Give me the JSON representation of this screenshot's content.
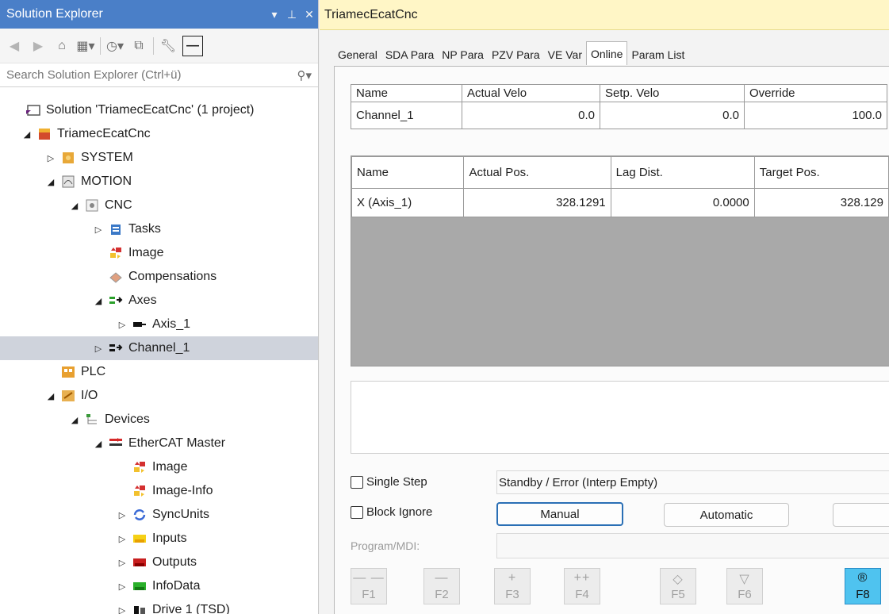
{
  "solution_explorer": {
    "title": "Solution Explorer",
    "title_controls": [
      "▾",
      "ᵖ",
      "✕"
    ],
    "search_placeholder": "Search Solution Explorer (Ctrl+ü)",
    "tree": [
      {
        "label": "Solution 'TriamecEcatCnc' (1 project)",
        "depth": 0,
        "expander": "",
        "icon": "solution-icon"
      },
      {
        "label": "TriamecEcatCnc",
        "depth": 1,
        "expander": "◢",
        "icon": "project-icon"
      },
      {
        "label": "SYSTEM",
        "depth": 2,
        "expander": "▷",
        "icon": "system-icon"
      },
      {
        "label": "MOTION",
        "depth": 2,
        "expander": "◢",
        "icon": "motion-icon"
      },
      {
        "label": "CNC",
        "depth": 3,
        "expander": "◢",
        "icon": "cnc-icon"
      },
      {
        "label": "Tasks",
        "depth": 4,
        "expander": "▷",
        "icon": "tasks-icon"
      },
      {
        "label": "Image",
        "depth": 4,
        "expander": "",
        "icon": "image-icon"
      },
      {
        "label": "Compensations",
        "depth": 4,
        "expander": "",
        "icon": "compensations-icon"
      },
      {
        "label": "Axes",
        "depth": 4,
        "expander": "◢",
        "icon": "axes-icon"
      },
      {
        "label": "Axis_1",
        "depth": 5,
        "expander": "▷",
        "icon": "axis-icon"
      },
      {
        "label": "Channel_1",
        "depth": 4,
        "expander": "▷",
        "icon": "channel-icon",
        "selected": true
      },
      {
        "label": "PLC",
        "depth": 2,
        "expander": "",
        "icon": "plc-icon"
      },
      {
        "label": "I/O",
        "depth": 2,
        "expander": "◢",
        "icon": "io-icon"
      },
      {
        "label": "Devices",
        "depth": 3,
        "expander": "◢",
        "icon": "devices-icon"
      },
      {
        "label": "EtherCAT Master",
        "depth": 4,
        "expander": "◢",
        "icon": "ethercat-icon"
      },
      {
        "label": "Image",
        "depth": 5,
        "expander": "",
        "icon": "image-icon"
      },
      {
        "label": "Image-Info",
        "depth": 5,
        "expander": "",
        "icon": "image-icon"
      },
      {
        "label": "SyncUnits",
        "depth": 5,
        "expander": "▷",
        "icon": "syncunits-icon"
      },
      {
        "label": "Inputs",
        "depth": 5,
        "expander": "▷",
        "icon": "inputs-icon"
      },
      {
        "label": "Outputs",
        "depth": 5,
        "expander": "▷",
        "icon": "outputs-icon"
      },
      {
        "label": "InfoData",
        "depth": 5,
        "expander": "▷",
        "icon": "infodata-icon"
      },
      {
        "label": "Drive 1 (TSD)",
        "depth": 5,
        "expander": "▷",
        "icon": "drive-icon"
      }
    ]
  },
  "document": {
    "tab_title": "TriamecEcatCnc",
    "tabs": [
      "General",
      "SDA Para",
      "NP Para",
      "PZV Para",
      "VE Var",
      "Online",
      "Param List"
    ],
    "active_tab": "Online",
    "channel_table": {
      "headers": [
        "Name",
        "Actual Velo",
        "Setp. Velo",
        "Override"
      ],
      "rows": [
        [
          "Channel_1",
          "0.0",
          "0.0",
          "100.0"
        ]
      ]
    },
    "axis_table": {
      "headers": [
        "Name",
        "Actual Pos.",
        "Lag Dist.",
        "Target Pos."
      ],
      "rows": [
        [
          "X (Axis_1)",
          "328.1291",
          "0.0000",
          "328.129"
        ]
      ]
    },
    "single_step_label": "Single Step",
    "block_ignore_label": "Block Ignore",
    "status_text": "Standby / Error (Interp Empty)",
    "manual_label": "Manual",
    "automatic_label": "Automatic",
    "program_mdi_label": "Program/MDI:",
    "function_keys": [
      {
        "sym": "— —",
        "label": "F1",
        "active": false
      },
      {
        "sym": "—",
        "label": "F2",
        "active": false
      },
      {
        "sym": "+",
        "label": "F3",
        "active": false
      },
      {
        "sym": "++",
        "label": "F4",
        "active": false
      },
      {
        "sym": "◇",
        "label": "F5",
        "active": false
      },
      {
        "sym": "▽",
        "label": "F6",
        "active": false
      },
      {
        "sym": "®",
        "label": "F8",
        "active": true
      }
    ],
    "colors": {
      "doc_tab_bg": "#fff6c6",
      "se_title_bg": "#4a7fc8",
      "selection_bg": "#cfd3dc",
      "f8_active": "#4fc3ef"
    }
  }
}
